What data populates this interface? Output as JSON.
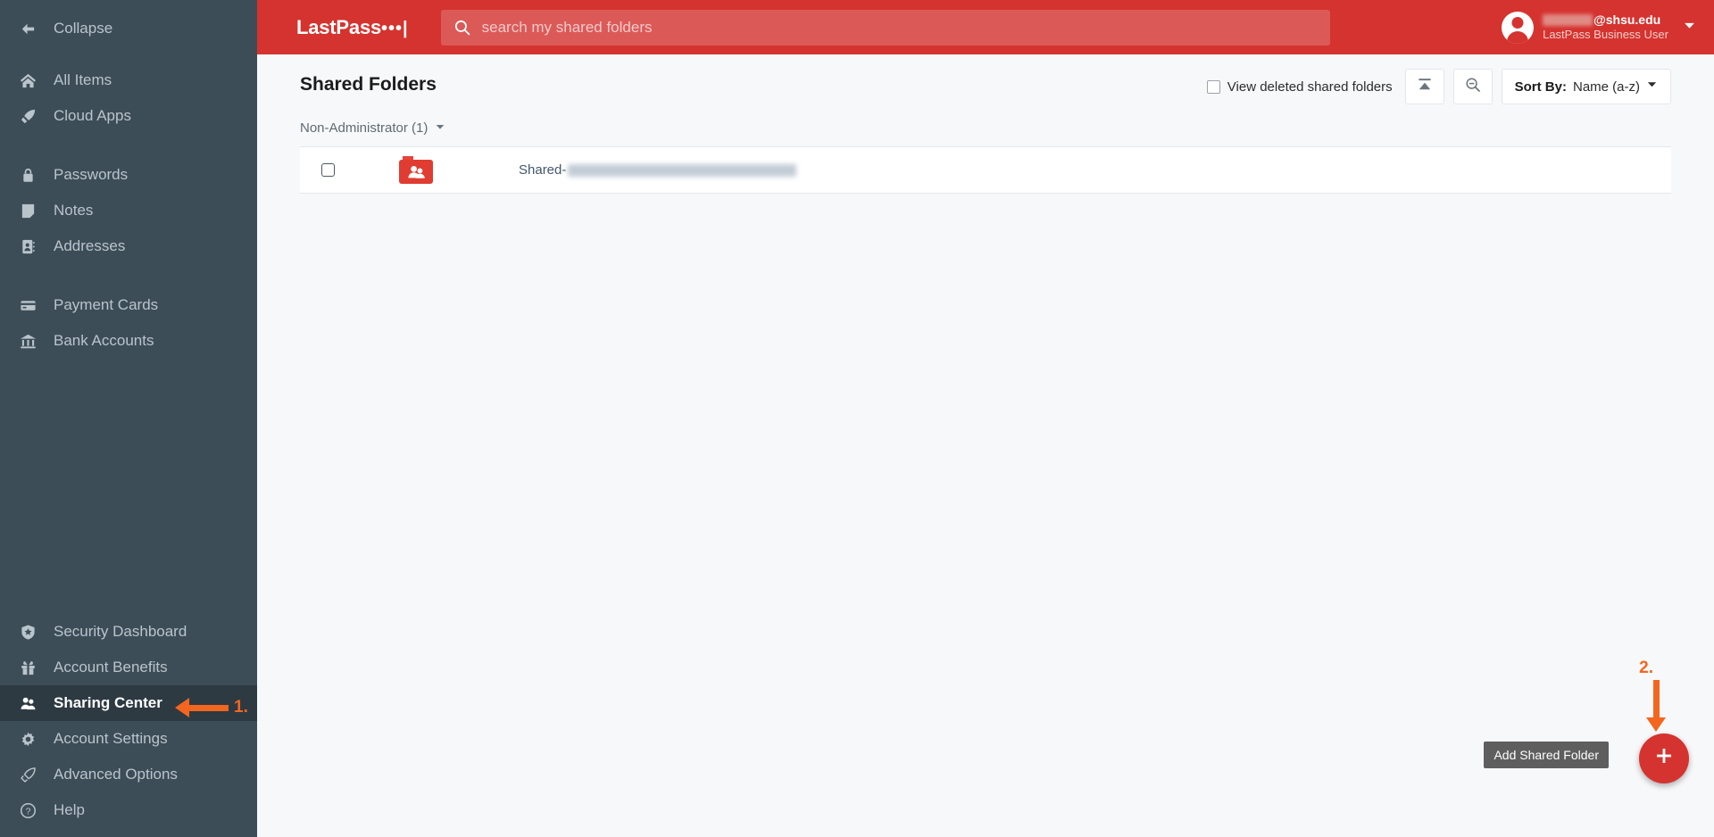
{
  "colors": {
    "sidebar_bg": "#3d4d57",
    "sidebar_active_bg": "#2d3a42",
    "header_red": "#d5332f",
    "search_bg": "#db5a58",
    "annotation_orange": "#f4651f",
    "content_bg": "#f7f8fa",
    "folder_red": "#e03c31"
  },
  "sidebar": {
    "collapse": {
      "label": "Collapse",
      "icon": "arrow-left-icon"
    },
    "top_items": [
      {
        "label": "All Items",
        "icon": "home-icon",
        "active": false
      },
      {
        "label": "Cloud Apps",
        "icon": "rocket-icon",
        "active": false
      }
    ],
    "type_items": [
      {
        "label": "Passwords",
        "icon": "lock-icon",
        "active": false
      },
      {
        "label": "Notes",
        "icon": "note-icon",
        "active": false
      },
      {
        "label": "Addresses",
        "icon": "address-book-icon",
        "active": false
      }
    ],
    "finance_items": [
      {
        "label": "Payment Cards",
        "icon": "credit-card-icon",
        "active": false
      },
      {
        "label": "Bank Accounts",
        "icon": "bank-icon",
        "active": false
      }
    ],
    "bottom_items": [
      {
        "label": "Security Dashboard",
        "icon": "shield-star-icon",
        "active": false
      },
      {
        "label": "Account Benefits",
        "icon": "gift-icon",
        "active": false
      },
      {
        "label": "Sharing Center",
        "icon": "people-icon",
        "active": true
      },
      {
        "label": "Account Settings",
        "icon": "gear-icon",
        "active": false
      },
      {
        "label": "Advanced Options",
        "icon": "rocket-outline-icon",
        "active": false
      },
      {
        "label": "Help",
        "icon": "question-circle-icon",
        "active": false
      }
    ]
  },
  "header": {
    "brand": "LastPass",
    "brand_dots": "•••|",
    "search": {
      "placeholder": "search my shared folders",
      "value": "",
      "icon": "search-icon"
    },
    "account": {
      "email_suffix": "@shsu.edu",
      "role": "LastPass Business User",
      "caret_icon": "chevron-down-icon",
      "avatar_icon": "avatar-icon"
    }
  },
  "content": {
    "page_title": "Shared Folders",
    "toolbar": {
      "view_deleted_label": "View deleted shared folders",
      "view_deleted_checked": false,
      "collapse_all_icon": "collapse-all-icon",
      "zoom_out_icon": "magnifier-minus-icon",
      "sort_label": "Sort By:",
      "sort_value": "Name (a-z)",
      "sort_caret_icon": "chevron-down-icon"
    },
    "group": {
      "label": "Non-Administrator (1)",
      "caret_icon": "caret-down-icon",
      "expanded": true
    },
    "rows": [
      {
        "name_prefix": "Shared-",
        "name_redacted": true,
        "checked": false,
        "folder_icon": "shared-folder-icon"
      }
    ]
  },
  "fab": {
    "tooltip": "Add Shared Folder",
    "icon": "plus-icon"
  },
  "annotations": [
    {
      "id": "1",
      "label": "1.",
      "direction": "left",
      "target": "Sharing Center"
    },
    {
      "id": "2",
      "label": "2.",
      "direction": "down",
      "target": "Add Shared Folder"
    }
  ]
}
